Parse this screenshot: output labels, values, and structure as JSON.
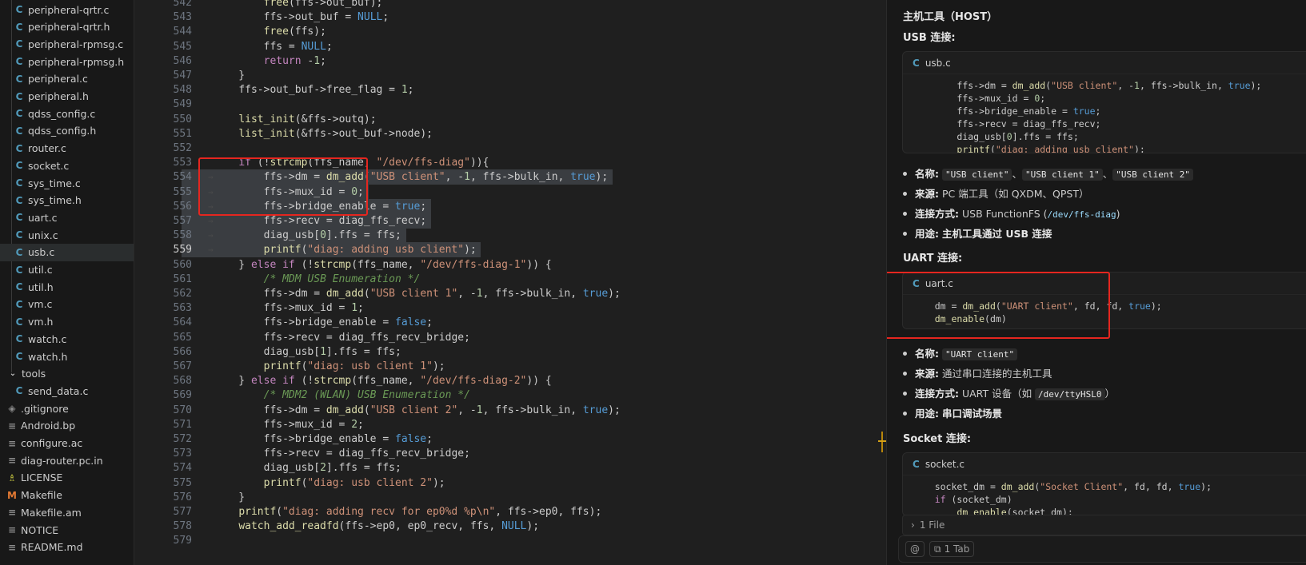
{
  "sidebar": {
    "items": [
      {
        "label": "peripheral-qrtr.c",
        "icon": "c-file-icon"
      },
      {
        "label": "peripheral-qrtr.h",
        "icon": "c-file-icon"
      },
      {
        "label": "peripheral-rpmsg.c",
        "icon": "c-file-icon"
      },
      {
        "label": "peripheral-rpmsg.h",
        "icon": "c-file-icon"
      },
      {
        "label": "peripheral.c",
        "icon": "c-file-icon"
      },
      {
        "label": "peripheral.h",
        "icon": "c-file-icon"
      },
      {
        "label": "qdss_config.c",
        "icon": "c-file-icon"
      },
      {
        "label": "qdss_config.h",
        "icon": "c-file-icon"
      },
      {
        "label": "router.c",
        "icon": "c-file-icon"
      },
      {
        "label": "socket.c",
        "icon": "c-file-icon"
      },
      {
        "label": "sys_time.c",
        "icon": "c-file-icon"
      },
      {
        "label": "sys_time.h",
        "icon": "c-file-icon"
      },
      {
        "label": "uart.c",
        "icon": "c-file-icon"
      },
      {
        "label": "unix.c",
        "icon": "c-file-icon"
      },
      {
        "label": "usb.c",
        "icon": "c-file-icon",
        "active": true
      },
      {
        "label": "util.c",
        "icon": "c-file-icon"
      },
      {
        "label": "util.h",
        "icon": "c-file-icon"
      },
      {
        "label": "vm.c",
        "icon": "c-file-icon"
      },
      {
        "label": "vm.h",
        "icon": "c-file-icon"
      },
      {
        "label": "watch.c",
        "icon": "c-file-icon"
      },
      {
        "label": "watch.h",
        "icon": "c-file-icon"
      },
      {
        "label": "tools",
        "icon": "chevron-down-icon"
      },
      {
        "label": "send_data.c",
        "icon": "c-file-icon"
      },
      {
        "label": ".gitignore",
        "icon": "gitignore-icon"
      },
      {
        "label": "Android.bp",
        "icon": "list-file-icon"
      },
      {
        "label": "configure.ac",
        "icon": "list-file-icon"
      },
      {
        "label": "diag-router.pc.in",
        "icon": "list-file-icon"
      },
      {
        "label": "LICENSE",
        "icon": "license-icon"
      },
      {
        "label": "Makefile",
        "icon": "makefile-icon"
      },
      {
        "label": "Makefile.am",
        "icon": "list-file-icon"
      },
      {
        "label": "NOTICE",
        "icon": "list-file-icon"
      },
      {
        "label": "README.md",
        "icon": "list-file-icon"
      }
    ]
  },
  "editor": {
    "current_line": 559,
    "lines": [
      {
        "n": 542,
        "code": "        free(ffs->out_buf);"
      },
      {
        "n": 543,
        "code": "        ffs->out_buf = NULL;"
      },
      {
        "n": 544,
        "code": "        free(ffs);"
      },
      {
        "n": 545,
        "code": "        ffs = NULL;"
      },
      {
        "n": 546,
        "code": "        return -1;"
      },
      {
        "n": 547,
        "code": "    }"
      },
      {
        "n": 548,
        "code": "    ffs->out_buf->free_flag = 1;"
      },
      {
        "n": 549,
        "code": ""
      },
      {
        "n": 550,
        "code": "    list_init(&ffs->outq);"
      },
      {
        "n": 551,
        "code": "    list_init(&ffs->out_buf->node);"
      },
      {
        "n": 552,
        "code": ""
      },
      {
        "n": 553,
        "code": "    if (!strcmp(ffs_name, \"/dev/ffs-diag\")){"
      },
      {
        "n": 554,
        "code": "        ffs->dm = dm_add(\"USB client\", -1, ffs->bulk_in, true);"
      },
      {
        "n": 555,
        "code": "        ffs->mux_id = 0;"
      },
      {
        "n": 556,
        "code": "        ffs->bridge_enable = true;"
      },
      {
        "n": 557,
        "code": "        ffs->recv = diag_ffs_recv;"
      },
      {
        "n": 558,
        "code": "        diag_usb[0].ffs = ffs;"
      },
      {
        "n": 559,
        "code": "        printf(\"diag: adding usb client\");"
      },
      {
        "n": 560,
        "code": "    } else if (!strcmp(ffs_name, \"/dev/ffs-diag-1\")) {"
      },
      {
        "n": 561,
        "code": "        /* MDM USB Enumeration */"
      },
      {
        "n": 562,
        "code": "        ffs->dm = dm_add(\"USB client 1\", -1, ffs->bulk_in, true);"
      },
      {
        "n": 563,
        "code": "        ffs->mux_id = 1;"
      },
      {
        "n": 564,
        "code": "        ffs->bridge_enable = false;"
      },
      {
        "n": 565,
        "code": "        ffs->recv = diag_ffs_recv_bridge;"
      },
      {
        "n": 566,
        "code": "        diag_usb[1].ffs = ffs;"
      },
      {
        "n": 567,
        "code": "        printf(\"diag: usb client 1\");"
      },
      {
        "n": 568,
        "code": "    } else if (!strcmp(ffs_name, \"/dev/ffs-diag-2\")) {"
      },
      {
        "n": 569,
        "code": "        /* MDM2 (WLAN) USB Enumeration */"
      },
      {
        "n": 570,
        "code": "        ffs->dm = dm_add(\"USB client 2\", -1, ffs->bulk_in, true);"
      },
      {
        "n": 571,
        "code": "        ffs->mux_id = 2;"
      },
      {
        "n": 572,
        "code": "        ffs->bridge_enable = false;"
      },
      {
        "n": 573,
        "code": "        ffs->recv = diag_ffs_recv_bridge;"
      },
      {
        "n": 574,
        "code": "        diag_usb[2].ffs = ffs;"
      },
      {
        "n": 575,
        "code": "        printf(\"diag: usb client 2\");"
      },
      {
        "n": 576,
        "code": "    }"
      },
      {
        "n": 577,
        "code": "    printf(\"diag: adding recv for ep0%d %p\\n\", ffs->ep0, ffs);"
      },
      {
        "n": 578,
        "code": "    watch_add_readfd(ffs->ep0, ep0_recv, ffs, NULL);"
      },
      {
        "n": 579,
        "code": ""
      }
    ]
  },
  "chat": {
    "host_heading": "主机工具（HOST）",
    "usb_heading": "USB 连接:",
    "usb_card": {
      "file": "usb.c",
      "code": [
        "        ffs->dm = dm_add(\"USB client\", -1, ffs->bulk_in, true);",
        "        ffs->mux_id = 0;",
        "        ffs->bridge_enable = true;",
        "        ffs->recv = diag_ffs_recv;",
        "        diag_usb[0].ffs = ffs;",
        "        printf(\"diag: adding usb client\");"
      ]
    },
    "usb_bullets": {
      "name_label": "名称:",
      "name_values": [
        "\"USB client\"",
        "\"USB client 1\"",
        "\"USB client 2\""
      ],
      "name_sep": "、",
      "source_label": "来源:",
      "source_value": "PC 端工具（如 QXDM、QPST）",
      "conn_label": "连接方式:",
      "conn_value_pre": "USB FunctionFS (",
      "conn_value_code": "/dev/ffs-diag",
      "conn_value_post": ")",
      "use_label": "用途:",
      "use_value": "主机工具通过 USB 连接"
    },
    "uart_heading": "UART 连接:",
    "uart_card": {
      "file": "uart.c",
      "code": [
        "    dm = dm_add(\"UART client\", fd, fd, true);",
        "    dm_enable(dm)"
      ]
    },
    "uart_bullets": {
      "name_label": "名称:",
      "name_value": "\"UART client\"",
      "source_label": "来源:",
      "source_value": "通过串口连接的主机工具",
      "conn_label": "连接方式:",
      "conn_value_pre": "UART 设备（如 ",
      "conn_value_code": "/dev/ttyHSL0",
      "conn_value_post": "）",
      "use_label": "用途:",
      "use_value": "串口调试场景"
    },
    "socket_heading": "Socket 连接:",
    "socket_card": {
      "file": "socket.c",
      "code": [
        "    socket_dm = dm_add(\"Socket Client\", fd, fd, true);",
        "    if (socket_dm)",
        "        dm_enable(socket_dm);"
      ]
    },
    "files_bar": "1 File",
    "input_bar": {
      "at": "@",
      "tab": "1 Tab"
    }
  }
}
